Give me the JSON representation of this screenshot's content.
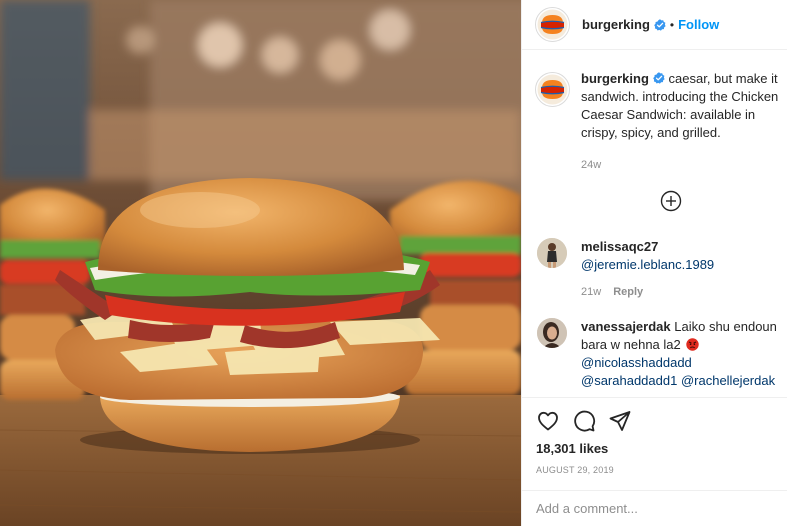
{
  "post": {
    "photo_icon": "burger-photo",
    "header": {
      "username": "burgerking",
      "dot": "•",
      "follow_label": "Follow",
      "avatar_logo_top": "BURGER",
      "avatar_logo_bottom": "KING"
    },
    "caption": {
      "username": "burgerking",
      "text": "caesar, but make it sandwich. introducing the Chicken Caesar Sandwich: available in crispy, spicy, and grilled.",
      "time": "24w"
    },
    "load_more_icon": "plus-circle-icon",
    "comments": [
      {
        "username": "melissaqc27",
        "text_parts": [
          "@jeremie.leblanc.1989"
        ],
        "time": "21w",
        "reply_label": "Reply"
      },
      {
        "username": "vanessajerdak",
        "text": "Laiko shu endoun bara w nehna la2",
        "mentions": [
          "@nicolasshaddadd",
          "@sarahaddadd1",
          "@rachellejerdak"
        ],
        "emoji": "angry-face"
      }
    ],
    "actions": {
      "like_icon": "heart-icon",
      "comment_icon": "comment-icon",
      "share_icon": "send-icon",
      "likes": "18,301 likes",
      "date": "AUGUST 29, 2019"
    },
    "add_comment_placeholder": "Add a comment..."
  },
  "colors": {
    "link": "#0095f6",
    "mention": "#00376b",
    "muted": "#8e8e8e",
    "brand_orange": "#f5821f",
    "brand_red": "#d62300",
    "brand_blue": "#1c5fb0"
  }
}
